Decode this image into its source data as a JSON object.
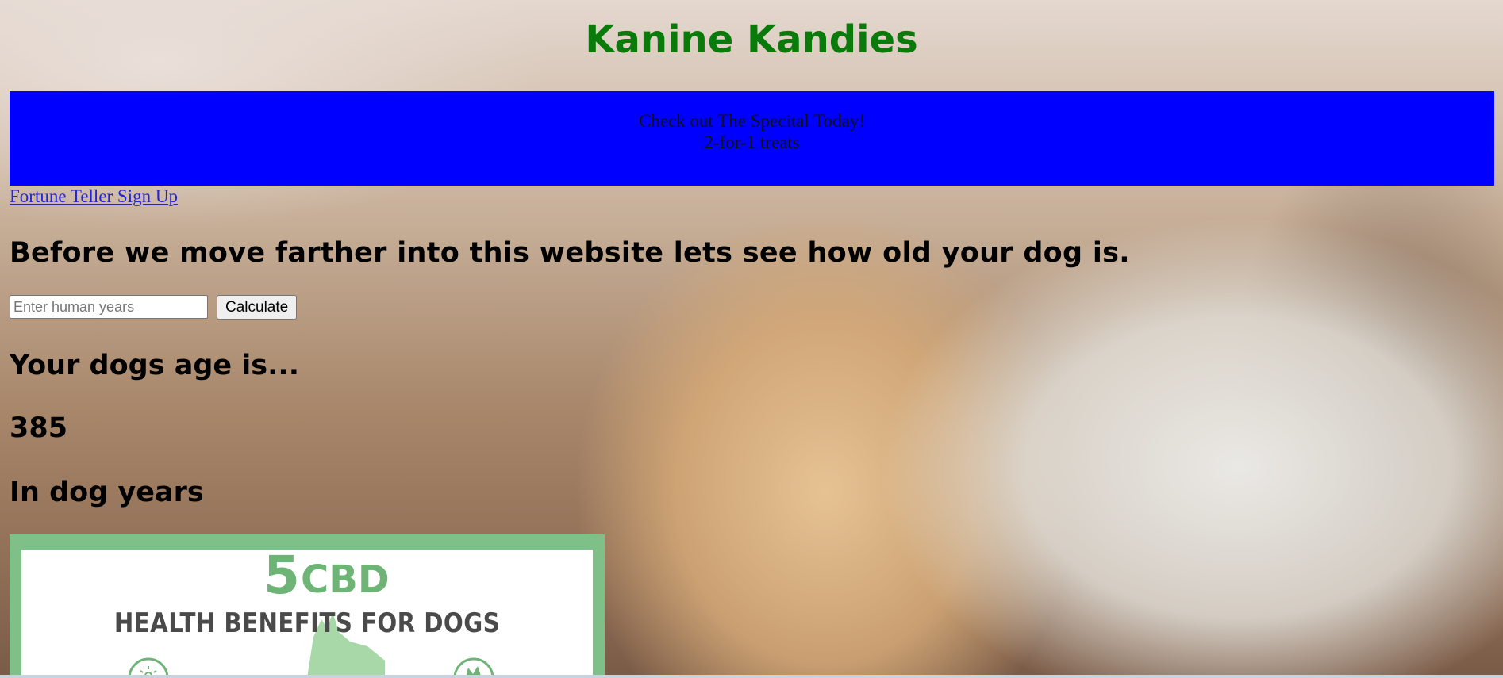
{
  "header": {
    "title": "Kanine Kandies"
  },
  "banner": {
    "line1": "Check out The Specital Today!",
    "line2": "2-for-1 treats"
  },
  "nav": {
    "fortune_link": "Fortune Teller Sign Up"
  },
  "calculator": {
    "intro": "Before we move farther into this website lets see how old your dog is.",
    "input_placeholder": "Enter human years",
    "input_value": "",
    "button_label": "Calculate",
    "result_label": "Your dogs age is...",
    "result_value": "385",
    "result_suffix": "In dog years"
  },
  "promo": {
    "number": "5",
    "brand": "CBD",
    "headline": "HEALTH BENEFITS FOR DOGS"
  },
  "colors": {
    "title_green": "#0a7a0a",
    "banner_blue": "#0000ff",
    "promo_green": "#7fbf88",
    "link_blue": "#2525d8"
  },
  "icons": [
    "dog-silhouette-icon",
    "sun-icon",
    "pets-icon"
  ]
}
